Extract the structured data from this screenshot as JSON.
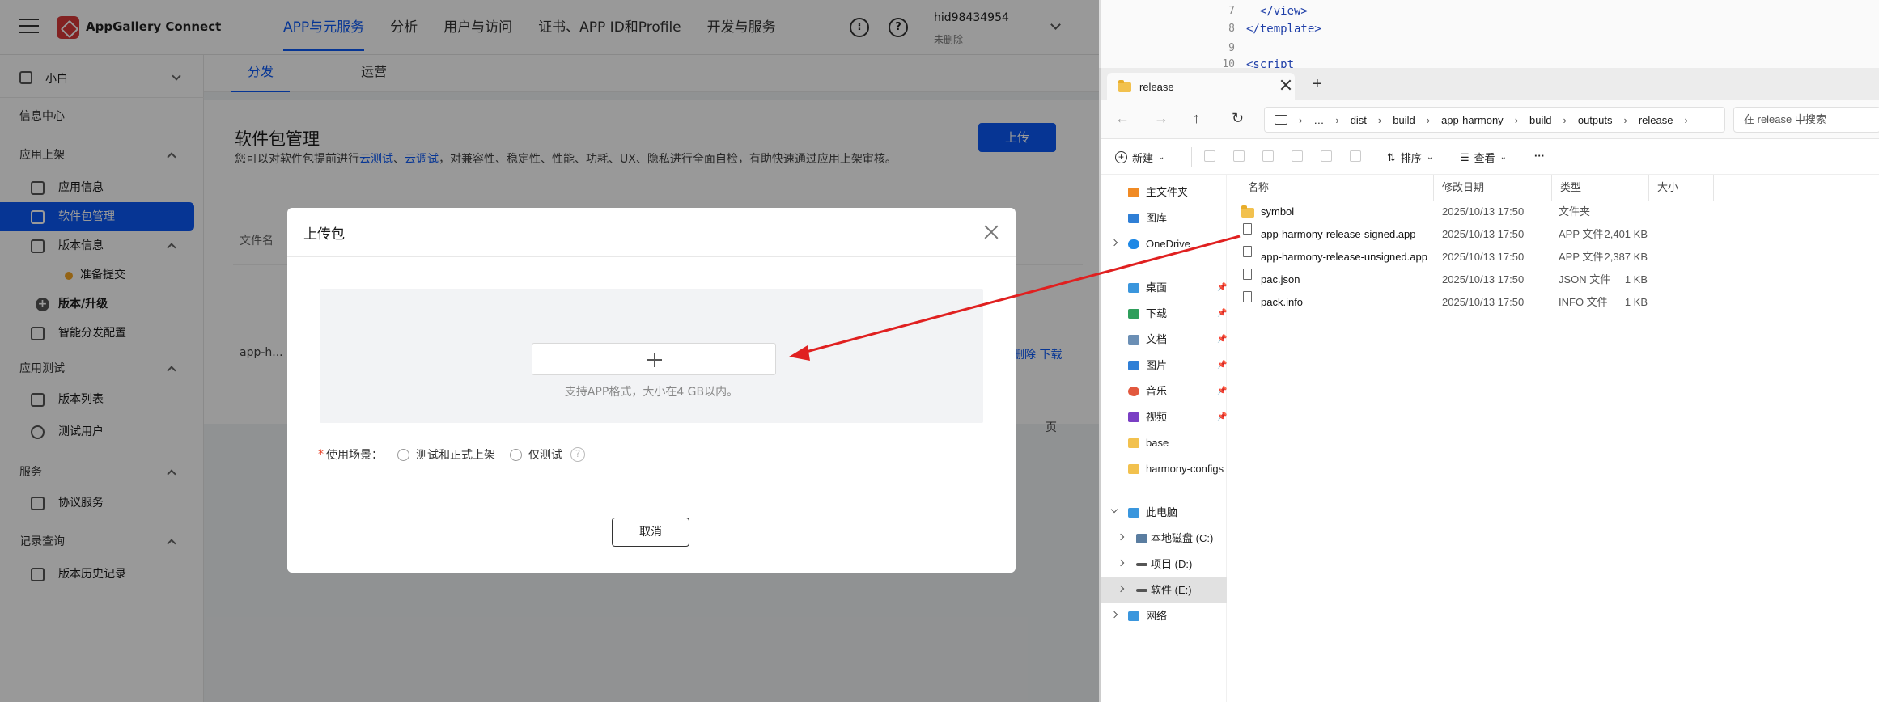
{
  "agc": {
    "brand": "AppGallery Connect",
    "nav": [
      "APP与元服务",
      "分析",
      "用户与访问",
      "证书、APP ID和Profile",
      "开发与服务"
    ],
    "user_id": "hid98434954",
    "user_sub": "未删除",
    "project": "小白",
    "sidebar": {
      "info_center": "信息中心",
      "app_release": "应用上架",
      "app_info": "应用信息",
      "package_mgmt": "软件包管理",
      "version_info": "版本信息",
      "prepare_submit": "准备提交",
      "version_upgrade": "版本/升级",
      "smart_dist": "智能分发配置",
      "app_test": "应用测试",
      "version_list": "版本列表",
      "test_users": "测试用户",
      "services": "服务",
      "protocol_service": "协议服务",
      "records": "记录查询",
      "version_history": "版本历史记录"
    },
    "subtabs": [
      "分发",
      "运营"
    ],
    "page_title": "软件包管理",
    "desc_prefix": "您可以对软件包提前进行",
    "desc_link1": "云测试",
    "desc_sep": "、",
    "desc_link2": "云调试",
    "desc_suffix": "，对兼容性、稳定性、性能、功耗、UX、隐私进行全面自检，有助快速通过应用上架审核。",
    "upload_button": "上传",
    "table_col_filename": "文件名",
    "table_cell_filename": "app-h...",
    "row_actions": "删除  下载",
    "pager_suffix": "页"
  },
  "dialog": {
    "title": "上传包",
    "drop_hint": "支持APP格式，大小在4 GB以内。",
    "scene_label": "使用场景：",
    "option1": "测试和正式上架",
    "option2": "仅测试",
    "help": "?",
    "cancel": "取消"
  },
  "editor": {
    "lines": [
      {
        "num": "7",
        "code": "  </view>"
      },
      {
        "num": "8",
        "code": "</template>"
      },
      {
        "num": "9",
        "code": ""
      },
      {
        "num": "10",
        "code": "<script"
      }
    ]
  },
  "explorer": {
    "tab_title": "release",
    "new_tab": "+",
    "breadcrumbs": [
      "…",
      "dist",
      "build",
      "app-harmony",
      "build",
      "outputs",
      "release"
    ],
    "search_placeholder": "在 release 中搜索",
    "toolbar": {
      "new": "新建",
      "sort": "排序",
      "view": "查看",
      "more": "···"
    },
    "nav": {
      "home": "主文件夹",
      "gallery": "图库",
      "onedrive": "OneDrive",
      "desktop": "桌面",
      "downloads": "下载",
      "documents": "文档",
      "pictures": "图片",
      "music": "音乐",
      "videos": "视频",
      "base": "base",
      "harmony_configs": "harmony-configs",
      "this_pc": "此电脑",
      "drive_c": "本地磁盘 (C:)",
      "drive_d": "项目 (D:)",
      "drive_e": "软件 (E:)",
      "network": "网络"
    },
    "columns": {
      "name": "名称",
      "date": "修改日期",
      "type": "类型",
      "size": "大小"
    },
    "files": [
      {
        "name": "symbol",
        "date": "2025/10/13 17:50",
        "type": "文件夹",
        "size": ""
      },
      {
        "name": "app-harmony-release-signed.app",
        "date": "2025/10/13 17:50",
        "type": "APP 文件",
        "size": "2,401 KB"
      },
      {
        "name": "app-harmony-release-unsigned.app",
        "date": "2025/10/13 17:50",
        "type": "APP 文件",
        "size": "2,387 KB"
      },
      {
        "name": "pac.json",
        "date": "2025/10/13 17:50",
        "type": "JSON 文件",
        "size": "1 KB"
      },
      {
        "name": "pack.info",
        "date": "2025/10/13 17:50",
        "type": "INFO 文件",
        "size": "1 KB"
      }
    ]
  },
  "colors": {
    "accent": "#0a59f7",
    "annotation_arrow": "#e02020",
    "overlay": "rgba(0,0,0,0.4)"
  }
}
